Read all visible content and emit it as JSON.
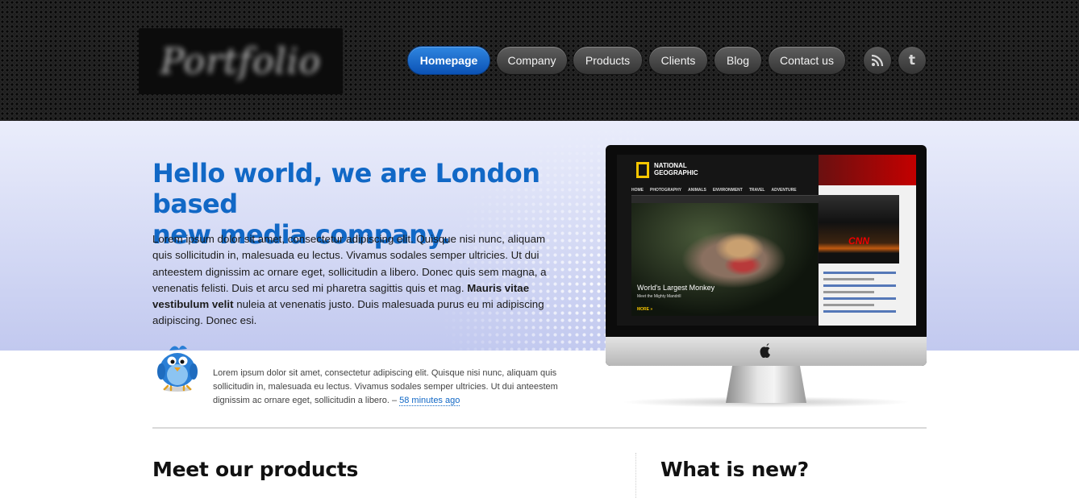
{
  "brand": {
    "logo_text": "Portfolio"
  },
  "nav": {
    "items": [
      {
        "label": "Homepage",
        "active": true
      },
      {
        "label": "Company",
        "active": false
      },
      {
        "label": "Products",
        "active": false
      },
      {
        "label": "Clients",
        "active": false
      },
      {
        "label": "Blog",
        "active": false
      },
      {
        "label": "Contact us",
        "active": false
      }
    ],
    "social": [
      {
        "icon": "rss-icon",
        "glyph": "◢"
      },
      {
        "icon": "twitter-icon",
        "glyph": "t"
      }
    ]
  },
  "hero": {
    "headline_line1": "Hello world, we are London based",
    "headline_line2": "new media company.",
    "lead_text": "Lorem ipsum dolor sit amet, consectetur adipiscing elit. Quisque nisi nunc, aliquam quis sollicitudin in, malesuada eu lectus. Vivamus sodales semper ultricies. Ut dui anteestem dignissim ac ornare eget, sollicitudin a libero. Donec quis sem magna, a venenatis felisti. Duis et arcu sed mi pharetra sagittis quis et mag. ",
    "lead_bold": "Mauris vitae vestibulum velit",
    "lead_text_end": " nuleia at venenatis justo. Duis malesuada purus eu mi adipiscing adipiscing. Donec esi."
  },
  "tweet": {
    "icon": "twitter-bird-icon",
    "text": "Lorem ipsum dolor sit amet, consectetur adipiscing elit. Quisque nisi nunc, aliquam quis sollicitudin in, malesuada eu lectus. Vivamus sodales semper ultricies. Ut dui anteestem dignissim ac ornare eget, sollicitudin a libero. – ",
    "time": "58 minutes ago"
  },
  "monitor": {
    "brand_line1": "NATIONAL",
    "brand_line2": "GEOGRAPHIC",
    "menu": [
      "HOME",
      "PHOTOGRAPHY",
      "ANIMALS",
      "ENVIRONMENT",
      "TRAVEL",
      "ADVENTURE"
    ],
    "caption": "World's Largest Monkey",
    "caption_sub": "Meet the Mighty Mandrill",
    "more": "MORE »",
    "news_logo": "CNN"
  },
  "sections": {
    "products_title": "Meet our products",
    "news_title": "What is new?"
  },
  "colors": {
    "accent": "#1168c6",
    "nav_active": "#0b52b5",
    "header_bg": "#1e1e1e",
    "hero_top": "#eaedfb",
    "hero_bottom": "#c2c9ef"
  }
}
